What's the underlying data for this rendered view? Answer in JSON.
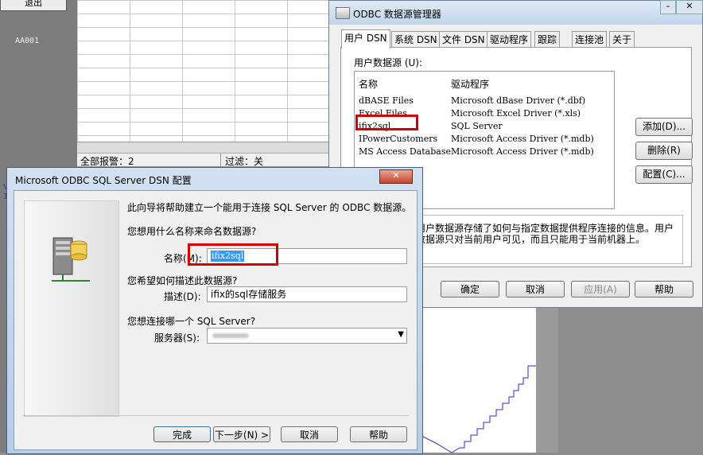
{
  "background_app": {
    "exit_label": "退出",
    "tag_label": "AA001",
    "status_total": "全部报警：2",
    "status_filter": "过滤：关",
    "side_marks": "V\n1"
  },
  "odbc": {
    "title": "ODBC 数据源管理器",
    "min_glyph": "–",
    "close_glyph": "✕",
    "tabs": [
      "用户 DSN",
      "系统 DSN",
      "文件 DSN",
      "驱动程序",
      "跟踪",
      "连接池",
      "关于"
    ],
    "list_label": "用户数据源 (U):",
    "col_name": "名称",
    "col_driver": "驱动程序",
    "rows": [
      {
        "name": "dBASE Files",
        "driver": "Microsoft dBase Driver (*.dbf)"
      },
      {
        "name": "Excel Files",
        "driver": "Microsoft Excel Driver (*.xls)"
      },
      {
        "name": "ifix2sql",
        "driver": "SQL Server"
      },
      {
        "name": "IPowerCustomers",
        "driver": "Microsoft Access Driver (*.mdb)"
      },
      {
        "name": "MS Access Database",
        "driver": "Microsoft Access Driver (*.mdb)"
      }
    ],
    "add_label": "添加(D)...",
    "remove_label": "删除(R)",
    "configure_label": "配置(C)...",
    "info_text": "用户数据源存储了如何与指定数据提供程序连接的信息。用户数据源只对当前用户可见，而且只能用于当前机器上。",
    "ok_label": "确定",
    "cancel_label": "取消",
    "apply_label": "应用(A)",
    "help_label": "帮助"
  },
  "sql_dialog": {
    "title": "Microsoft ODBC SQL Server DSN 配置",
    "close_glyph": "✕",
    "intro": "此向导将帮助建立一个能用于连接 SQL Server 的 ODBC 数据源。",
    "q_name": "您想用什么名称来命名数据源?",
    "name_label": "名称(M):",
    "name_value": "ifix2sql",
    "q_desc": "您希望如何描述此数据源?",
    "desc_label": "描述(D):",
    "desc_value": "ifix的sql存储服务",
    "q_server": "您想连接哪一个 SQL Server?",
    "server_label": "服务器(S):",
    "server_value": "",
    "finish_label": "完成",
    "next_label": "下一步(N) >",
    "cancel_label": "取消",
    "help_label": "帮助"
  },
  "colors": {
    "highlight_red": "#d00000",
    "selection_blue": "#3399ff",
    "trend_line": "#2a2ad0"
  }
}
